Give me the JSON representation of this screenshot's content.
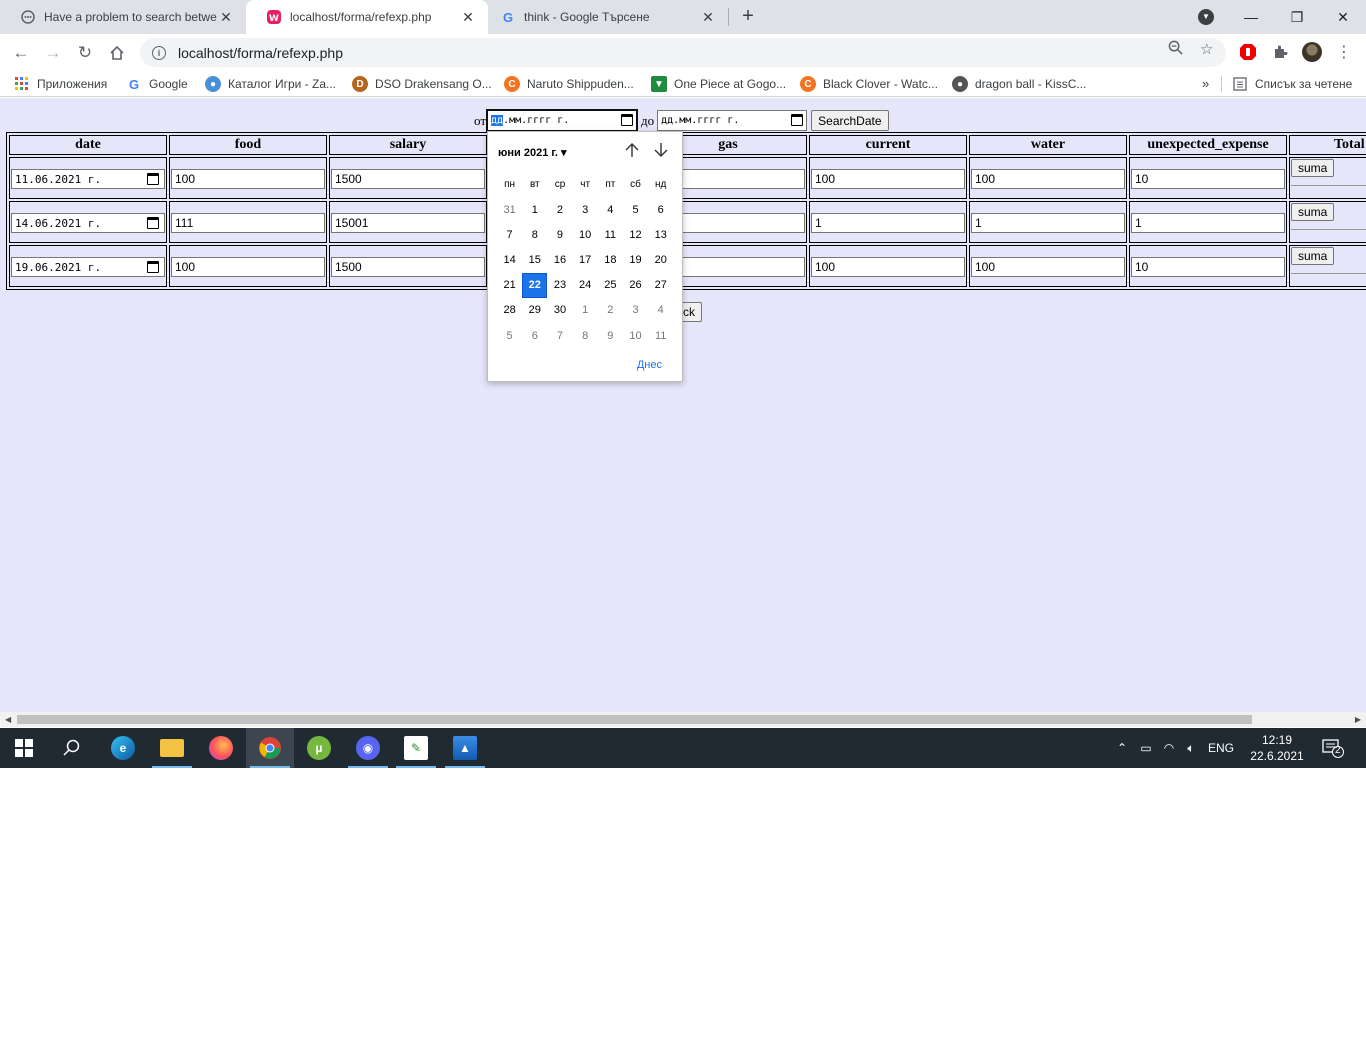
{
  "tabs": [
    {
      "title": "Have a problem to search betwe",
      "favicon": "chat-bubble-icon",
      "active": false
    },
    {
      "title": "localhost/forma/refexp.php",
      "favicon": "wamp-icon",
      "active": true
    },
    {
      "title": "think - Google Търсене",
      "favicon": "google-icon",
      "active": false
    }
  ],
  "address": {
    "url": "localhost/forma/refexp.php"
  },
  "bookmarks": [
    {
      "label": "Приложения",
      "icon": "apps-grid-icon"
    },
    {
      "label": "Google",
      "icon": "google-icon"
    },
    {
      "label": "Каталог Игри - Za...",
      "icon": "globe-icon"
    },
    {
      "label": "DSO Drakensang O...",
      "icon": "dso-icon"
    },
    {
      "label": "Naruto Shippuden...",
      "icon": "crunchyroll-icon"
    },
    {
      "label": "One Piece at Gogo...",
      "icon": "gogoanime-icon"
    },
    {
      "label": "Black Clover - Watc...",
      "icon": "crunchyroll-icon"
    },
    {
      "label": "dragon ball - KissC...",
      "icon": "globe-icon"
    }
  ],
  "reading_list": "Списък за четене",
  "search": {
    "from_label": "от",
    "to_label": "до",
    "from_day": "дд",
    "from_rest": ".мм.гггг г.",
    "to_value": "дд.мм.гггг г.",
    "button": "SearchDate"
  },
  "table": {
    "headers": [
      "date",
      "food",
      "salary",
      "",
      "gas",
      "current",
      "water",
      "unexpected_expense",
      "Total Pr"
    ],
    "rows": [
      {
        "date": "11.06.2021 г.",
        "food": "100",
        "salary": "1500",
        "gas": "",
        "current": "100",
        "water": "100",
        "unexpected": "10",
        "action": "suma"
      },
      {
        "date": "14.06.2021 г.",
        "food": "111",
        "salary": "15001",
        "gas": "",
        "current": "1",
        "water": "1",
        "unexpected": "1",
        "action": "suma"
      },
      {
        "date": "19.06.2021 г.",
        "food": "100",
        "salary": "1500",
        "gas": "",
        "current": "100",
        "water": "100",
        "unexpected": "10",
        "action": "suma"
      }
    ]
  },
  "back_button": "ck",
  "picker": {
    "month": "юни 2021 г. ▾",
    "weekdays": [
      "пн",
      "вт",
      "ср",
      "чт",
      "пт",
      "сб",
      "нд"
    ],
    "days": [
      "31",
      "1",
      "2",
      "3",
      "4",
      "5",
      "6",
      "7",
      "8",
      "9",
      "10",
      "11",
      "12",
      "13",
      "14",
      "15",
      "16",
      "17",
      "18",
      "19",
      "20",
      "21",
      "22",
      "23",
      "24",
      "25",
      "26",
      "27",
      "28",
      "29",
      "30",
      "1",
      "2",
      "3",
      "4",
      "5",
      "6",
      "7",
      "8",
      "9",
      "10",
      "11"
    ],
    "selected": "22",
    "today": "Днес"
  },
  "taskbar": {
    "lang": "ENG",
    "time": "12:19",
    "date": "22.6.2021 г.",
    "notifications": "2"
  },
  "colors": {
    "page_bg": "#e6e6fa",
    "accent": "#1a73e8",
    "taskbar": "#1f2a33"
  }
}
